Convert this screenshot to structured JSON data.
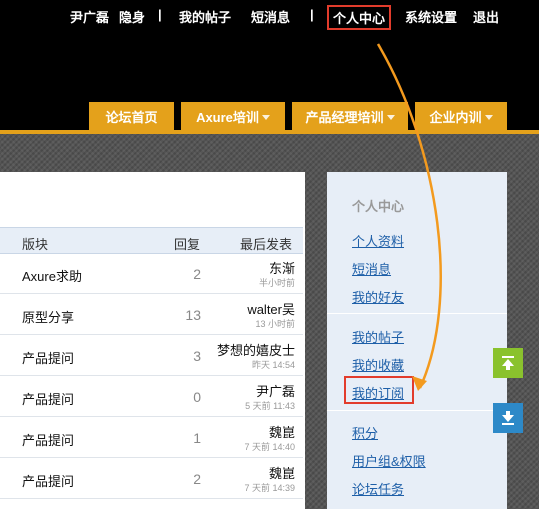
{
  "userbar": {
    "username": "尹广磊",
    "invisible": "隐身",
    "my_posts": "我的帖子",
    "messages": "短消息",
    "user_center": "个人中心",
    "settings": "系统设置",
    "logout": "退出"
  },
  "nav": {
    "tabs": [
      {
        "label": "论坛首页"
      },
      {
        "label": "Axure培训"
      },
      {
        "label": "产品经理培训"
      },
      {
        "label": "企业内训"
      }
    ]
  },
  "table": {
    "headers": {
      "board": "版块",
      "replies": "回复",
      "last_post": "最后发表"
    },
    "rows": [
      {
        "board": "Axure求助",
        "replies": "2",
        "author": "东渐",
        "time": "半小时前"
      },
      {
        "board": "原型分享",
        "replies": "13",
        "author": "walter吴",
        "time": "13 小时前"
      },
      {
        "board": "产品提问",
        "replies": "3",
        "author": "梦想的嬉皮士",
        "time": "昨天 14:54"
      },
      {
        "board": "产品提问",
        "replies": "0",
        "author": "尹广磊",
        "time": "5 天前 11:43"
      },
      {
        "board": "产品提问",
        "replies": "1",
        "author": "魏崑",
        "time": "7 天前 14:40"
      },
      {
        "board": "产品提问",
        "replies": "2",
        "author": "魏崑",
        "time": "7 天前 14:39"
      }
    ]
  },
  "sidebar": {
    "title": "个人中心",
    "links": [
      "个人资料",
      "短消息",
      "我的好友",
      "我的帖子",
      "我的收藏",
      "我的订阅",
      "积分",
      "用户组&权限",
      "论坛任务"
    ]
  },
  "colors": {
    "accent": "#e4a11b",
    "highlight": "#e23c2c",
    "arrow": "#f39a1e",
    "link": "#1e5fa8",
    "up_button": "#8ac22d",
    "down_button": "#2d89c8"
  },
  "icons": {
    "up_button": "arrow-to-top-icon",
    "down_button": "arrow-to-bottom-icon"
  }
}
